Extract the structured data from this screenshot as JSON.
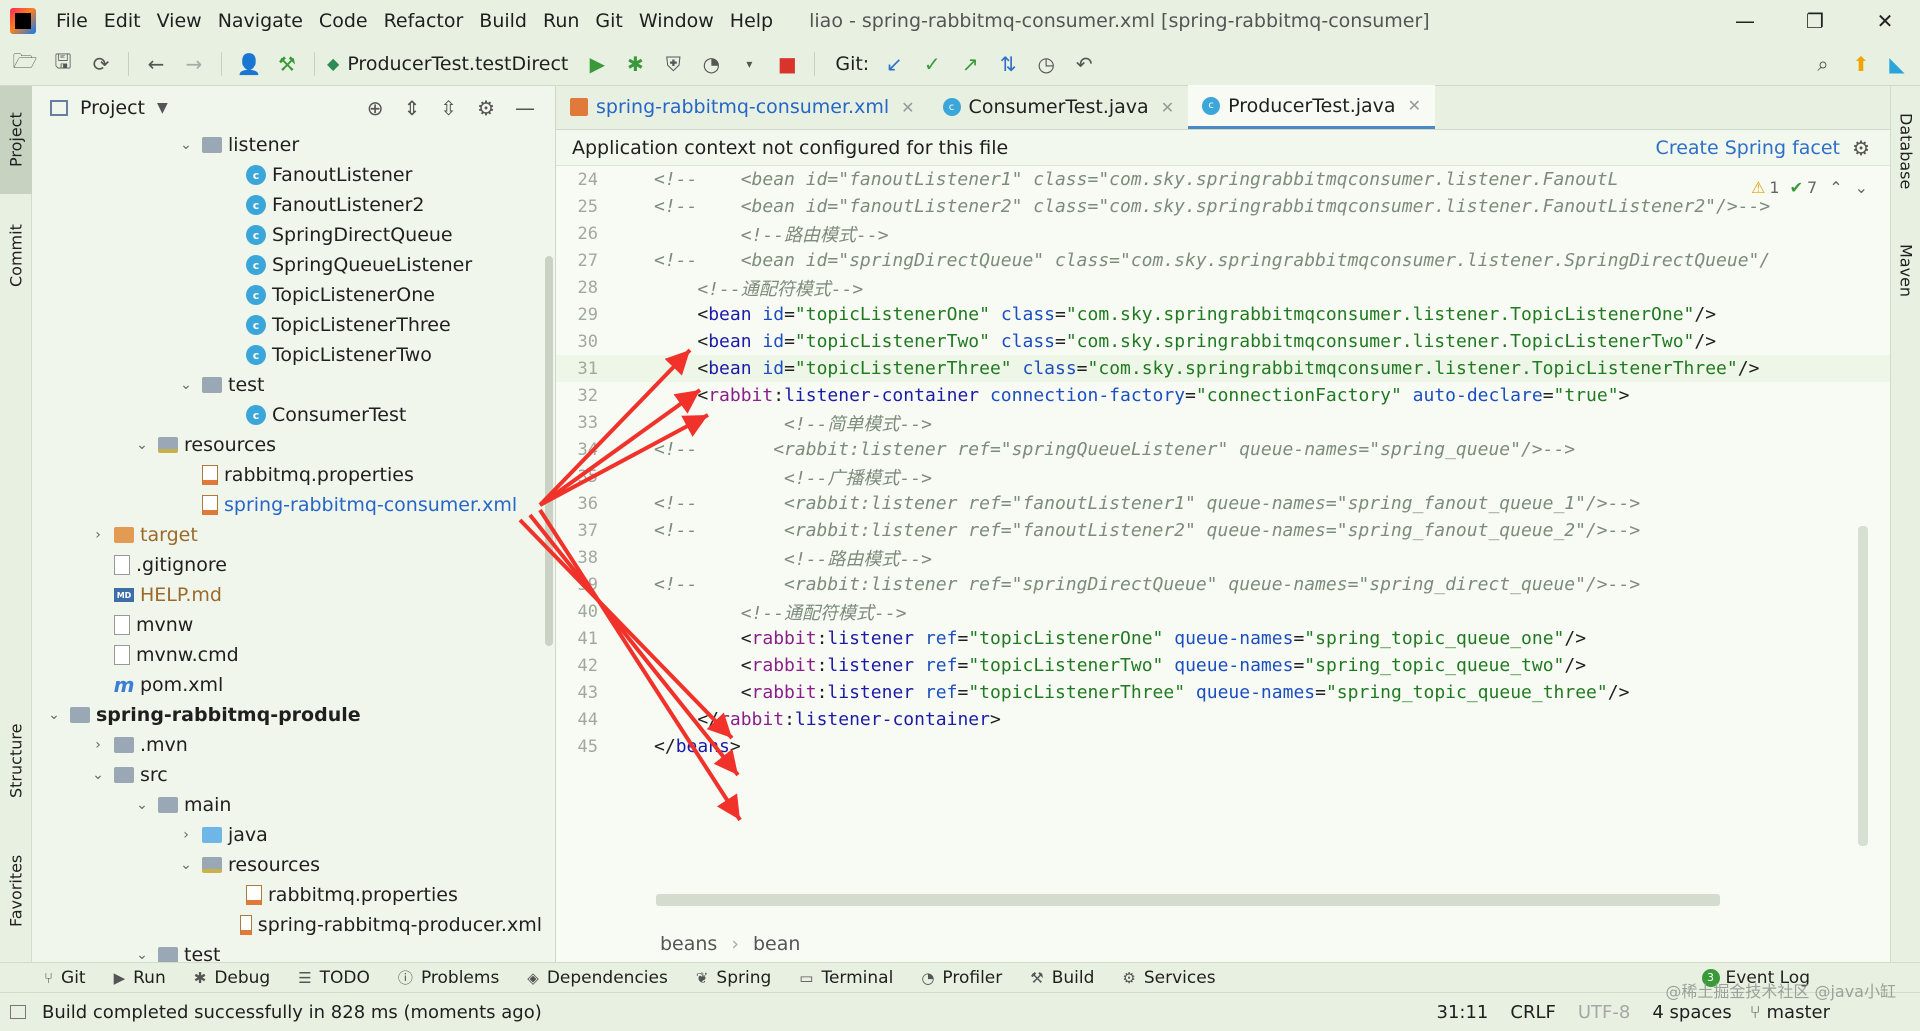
{
  "menubar": {
    "items": [
      "File",
      "Edit",
      "View",
      "Navigate",
      "Code",
      "Refactor",
      "Build",
      "Run",
      "Git",
      "Window",
      "Help"
    ],
    "title": "liao - spring-rabbitmq-consumer.xml [spring-rabbitmq-consumer]"
  },
  "toolbar": {
    "run_config": "ProducerTest.testDirect",
    "git_label": "Git:"
  },
  "left_stripe": {
    "tabs": [
      "Project",
      "Commit",
      "Structure",
      "Favorites"
    ]
  },
  "right_stripe": {
    "tabs": [
      "Database",
      "Maven"
    ]
  },
  "project_panel": {
    "title": "Project",
    "tree": [
      {
        "label": "listener",
        "indent": 7,
        "arrow": "⌄",
        "icon": "folder",
        "style": ""
      },
      {
        "label": "FanoutListener",
        "indent": 9,
        "arrow": "",
        "icon": "class",
        "style": ""
      },
      {
        "label": "FanoutListener2",
        "indent": 9,
        "arrow": "",
        "icon": "class",
        "style": ""
      },
      {
        "label": "SpringDirectQueue",
        "indent": 9,
        "arrow": "",
        "icon": "class",
        "style": ""
      },
      {
        "label": "SpringQueueListener",
        "indent": 9,
        "arrow": "",
        "icon": "class",
        "style": ""
      },
      {
        "label": "TopicListenerOne",
        "indent": 9,
        "arrow": "",
        "icon": "class",
        "style": ""
      },
      {
        "label": "TopicListenerThree",
        "indent": 9,
        "arrow": "",
        "icon": "class",
        "style": ""
      },
      {
        "label": "TopicListenerTwo",
        "indent": 9,
        "arrow": "",
        "icon": "class",
        "style": ""
      },
      {
        "label": "test",
        "indent": 7,
        "arrow": "⌄",
        "icon": "folder",
        "style": ""
      },
      {
        "label": "ConsumerTest",
        "indent": 9,
        "arrow": "",
        "icon": "class",
        "style": ""
      },
      {
        "label": "resources",
        "indent": 5,
        "arrow": "⌄",
        "icon": "folder-res",
        "style": ""
      },
      {
        "label": "rabbitmq.properties",
        "indent": 7,
        "arrow": "",
        "icon": "xml",
        "style": ""
      },
      {
        "label": "spring-rabbitmq-consumer.xml",
        "indent": 7,
        "arrow": "",
        "icon": "xml",
        "style": "blue"
      },
      {
        "label": "target",
        "indent": 3,
        "arrow": "›",
        "icon": "folder-orange",
        "style": "orange"
      },
      {
        "label": ".gitignore",
        "indent": 3,
        "arrow": "",
        "icon": "file",
        "style": ""
      },
      {
        "label": "HELP.md",
        "indent": 3,
        "arrow": "",
        "icon": "md",
        "style": "orange"
      },
      {
        "label": "mvnw",
        "indent": 3,
        "arrow": "",
        "icon": "file",
        "style": ""
      },
      {
        "label": "mvnw.cmd",
        "indent": 3,
        "arrow": "",
        "icon": "file",
        "style": ""
      },
      {
        "label": "pom.xml",
        "indent": 3,
        "arrow": "",
        "icon": "m",
        "style": ""
      },
      {
        "label": "spring-rabbitmq-produle",
        "indent": 1,
        "arrow": "⌄",
        "icon": "folder",
        "style": "bold"
      },
      {
        "label": ".mvn",
        "indent": 3,
        "arrow": "›",
        "icon": "folder",
        "style": ""
      },
      {
        "label": "src",
        "indent": 3,
        "arrow": "⌄",
        "icon": "folder",
        "style": ""
      },
      {
        "label": "main",
        "indent": 5,
        "arrow": "⌄",
        "icon": "folder",
        "style": ""
      },
      {
        "label": "java",
        "indent": 7,
        "arrow": "›",
        "icon": "folder-blue",
        "style": ""
      },
      {
        "label": "resources",
        "indent": 7,
        "arrow": "⌄",
        "icon": "folder-res",
        "style": ""
      },
      {
        "label": "rabbitmq.properties",
        "indent": 9,
        "arrow": "",
        "icon": "xml",
        "style": ""
      },
      {
        "label": "spring-rabbitmq-producer.xml",
        "indent": 9,
        "arrow": "",
        "icon": "xml",
        "style": ""
      },
      {
        "label": "test",
        "indent": 5,
        "arrow": "⌄",
        "icon": "folder",
        "style": ""
      }
    ]
  },
  "editor": {
    "tabs": [
      {
        "label": "spring-rabbitmq-consumer.xml",
        "icon": "xml",
        "active": false
      },
      {
        "label": "ConsumerTest.java",
        "icon": "class",
        "active": false
      },
      {
        "label": "ProducerTest.java",
        "icon": "class",
        "active": true
      }
    ],
    "notice": "Application context not configured for this file",
    "notice_link": "Create Spring facet",
    "inspections": {
      "warnings": "1",
      "ok": "7"
    },
    "current_line": 31,
    "lines": [
      {
        "n": "24",
        "tokens": [
          [
            "cm",
            "<!--    <bean id=\"fanoutListener1\" class=\"com.sky.springrabbitmqconsumer.listener.FanoutL"
          ]
        ]
      },
      {
        "n": "25",
        "tokens": [
          [
            "cm",
            "<!--    <bean id=\"fanoutListener2\" class=\"com.sky.springrabbitmqconsumer.listener.FanoutListener2\"/>-->"
          ]
        ]
      },
      {
        "n": "26",
        "tokens": [
          [
            "cm",
            "        <!--路由模式-->"
          ]
        ]
      },
      {
        "n": "27",
        "tokens": [
          [
            "cm",
            "<!--    <bean id=\"springDirectQueue\" class=\"com.sky.springrabbitmqconsumer.listener.SpringDirectQueue\"/"
          ]
        ]
      },
      {
        "n": "28",
        "tokens": [
          [
            "cm",
            "    <!--通配符模式-->"
          ]
        ]
      },
      {
        "n": "29",
        "tokens": [
          [
            "pun",
            "    <"
          ],
          [
            "tag",
            "bean "
          ],
          [
            "attr",
            "id"
          ],
          [
            "pun",
            "="
          ],
          [
            "str",
            "\"topicListenerOne\" "
          ],
          [
            "attr",
            "class"
          ],
          [
            "pun",
            "="
          ],
          [
            "str",
            "\"com.sky.springrabbitmqconsumer.listener.TopicListenerOne\""
          ],
          [
            "pun",
            "/>"
          ]
        ]
      },
      {
        "n": "30",
        "tokens": [
          [
            "pun",
            "    <"
          ],
          [
            "tag",
            "bean "
          ],
          [
            "attr",
            "id"
          ],
          [
            "pun",
            "="
          ],
          [
            "str",
            "\"topicListenerTwo\" "
          ],
          [
            "attr",
            "class"
          ],
          [
            "pun",
            "="
          ],
          [
            "str",
            "\"com.sky.springrabbitmqconsumer.listener.TopicListenerTwo\""
          ],
          [
            "pun",
            "/>"
          ]
        ]
      },
      {
        "n": "31",
        "tokens": [
          [
            "pun",
            "    <"
          ],
          [
            "tag",
            "bean "
          ],
          [
            "attr",
            "id"
          ],
          [
            "pun",
            "="
          ],
          [
            "str",
            "\"topicListenerThree\" "
          ],
          [
            "attr",
            "class"
          ],
          [
            "pun",
            "="
          ],
          [
            "str",
            "\"com.sky.springrabbitmqconsumer.listener.TopicListenerThree\""
          ],
          [
            "pun",
            "/>"
          ]
        ]
      },
      {
        "n": "32",
        "tokens": [
          [
            "pun",
            "    <"
          ],
          [
            "ns",
            "rabbit"
          ],
          [
            "pun",
            ":"
          ],
          [
            "tag",
            "listener-container "
          ],
          [
            "attr",
            "connection-factory"
          ],
          [
            "pun",
            "="
          ],
          [
            "str",
            "\"connectionFactory\" "
          ],
          [
            "attr",
            "auto-declare"
          ],
          [
            "pun",
            "="
          ],
          [
            "str",
            "\"true\""
          ],
          [
            "pun",
            ">"
          ]
        ]
      },
      {
        "n": "33",
        "tokens": [
          [
            "cm",
            "            <!--简单模式-->"
          ]
        ]
      },
      {
        "n": "34",
        "tokens": [
          [
            "cm",
            "<!--       <rabbit:listener ref=\"springQueueListener\" queue-names=\"spring_queue\"/>-->"
          ]
        ]
      },
      {
        "n": "35",
        "tokens": [
          [
            "cm",
            "            <!--广播模式-->"
          ]
        ]
      },
      {
        "n": "36",
        "tokens": [
          [
            "cm",
            "<!--        <rabbit:listener ref=\"fanoutListener1\" queue-names=\"spring_fanout_queue_1\"/>-->"
          ]
        ]
      },
      {
        "n": "37",
        "tokens": [
          [
            "cm",
            "<!--        <rabbit:listener ref=\"fanoutListener2\" queue-names=\"spring_fanout_queue_2\"/>-->"
          ]
        ]
      },
      {
        "n": "38",
        "tokens": [
          [
            "cm",
            "            <!--路由模式-->"
          ]
        ]
      },
      {
        "n": "39",
        "tokens": [
          [
            "cm",
            "<!--        <rabbit:listener ref=\"springDirectQueue\" queue-names=\"spring_direct_queue\"/>-->"
          ]
        ]
      },
      {
        "n": "40",
        "tokens": [
          [
            "cm",
            "        <!--通配符模式-->"
          ]
        ]
      },
      {
        "n": "41",
        "tokens": [
          [
            "pun",
            "        <"
          ],
          [
            "ns",
            "rabbit"
          ],
          [
            "pun",
            ":"
          ],
          [
            "tag",
            "listener "
          ],
          [
            "attr",
            "ref"
          ],
          [
            "pun",
            "="
          ],
          [
            "str",
            "\"topicListenerOne\" "
          ],
          [
            "attr",
            "queue-names"
          ],
          [
            "pun",
            "="
          ],
          [
            "str",
            "\"spring_topic_queue_one\""
          ],
          [
            "pun",
            "/>"
          ]
        ]
      },
      {
        "n": "42",
        "tokens": [
          [
            "pun",
            "        <"
          ],
          [
            "ns",
            "rabbit"
          ],
          [
            "pun",
            ":"
          ],
          [
            "tag",
            "listener "
          ],
          [
            "attr",
            "ref"
          ],
          [
            "pun",
            "="
          ],
          [
            "str",
            "\"topicListenerTwo\" "
          ],
          [
            "attr",
            "queue-names"
          ],
          [
            "pun",
            "="
          ],
          [
            "str",
            "\"spring_topic_queue_two\""
          ],
          [
            "pun",
            "/>"
          ]
        ]
      },
      {
        "n": "43",
        "tokens": [
          [
            "pun",
            "        <"
          ],
          [
            "ns",
            "rabbit"
          ],
          [
            "pun",
            ":"
          ],
          [
            "tag",
            "listener "
          ],
          [
            "attr",
            "ref"
          ],
          [
            "pun",
            "="
          ],
          [
            "str",
            "\"topicListenerThree\" "
          ],
          [
            "attr",
            "queue-names"
          ],
          [
            "pun",
            "="
          ],
          [
            "str",
            "\"spring_topic_queue_three\""
          ],
          [
            "pun",
            "/>"
          ]
        ]
      },
      {
        "n": "44",
        "tokens": [
          [
            "pun",
            "    </"
          ],
          [
            "ns",
            "rabbit"
          ],
          [
            "pun",
            ":"
          ],
          [
            "tag",
            "listener-container"
          ],
          [
            "pun",
            ">"
          ]
        ]
      },
      {
        "n": "45",
        "tokens": [
          [
            "pun",
            "</"
          ],
          [
            "tag",
            "beans"
          ],
          [
            "pun",
            ">"
          ]
        ]
      }
    ],
    "breadcrumb": [
      "beans",
      "bean"
    ]
  },
  "toolwindows": {
    "items": [
      {
        "label": "Git",
        "icon": "git-icon"
      },
      {
        "label": "Run",
        "icon": "run-icon"
      },
      {
        "label": "Debug",
        "icon": "debug-icon"
      },
      {
        "label": "TODO",
        "icon": "todo-icon"
      },
      {
        "label": "Problems",
        "icon": "problems-icon"
      },
      {
        "label": "Dependencies",
        "icon": "dependencies-icon"
      },
      {
        "label": "Spring",
        "icon": "spring-icon"
      },
      {
        "label": "Terminal",
        "icon": "terminal-icon"
      },
      {
        "label": "Profiler",
        "icon": "profiler-icon"
      },
      {
        "label": "Build",
        "icon": "build-icon"
      },
      {
        "label": "Services",
        "icon": "services-icon"
      }
    ],
    "event_log": "Event Log",
    "event_count": "3"
  },
  "statusbar": {
    "message": "Build completed successfully in 828 ms (moments ago)",
    "position": "31:11",
    "line_sep": "CRLF",
    "encoding": "UTF-8",
    "indent": "4 spaces",
    "branch": "master"
  },
  "watermark": "@稀土掘金技术社区 @java小缸",
  "colors": {
    "accent": "#2e6fc7",
    "arrow": "#f0322a",
    "background": "#e8f1e1"
  }
}
